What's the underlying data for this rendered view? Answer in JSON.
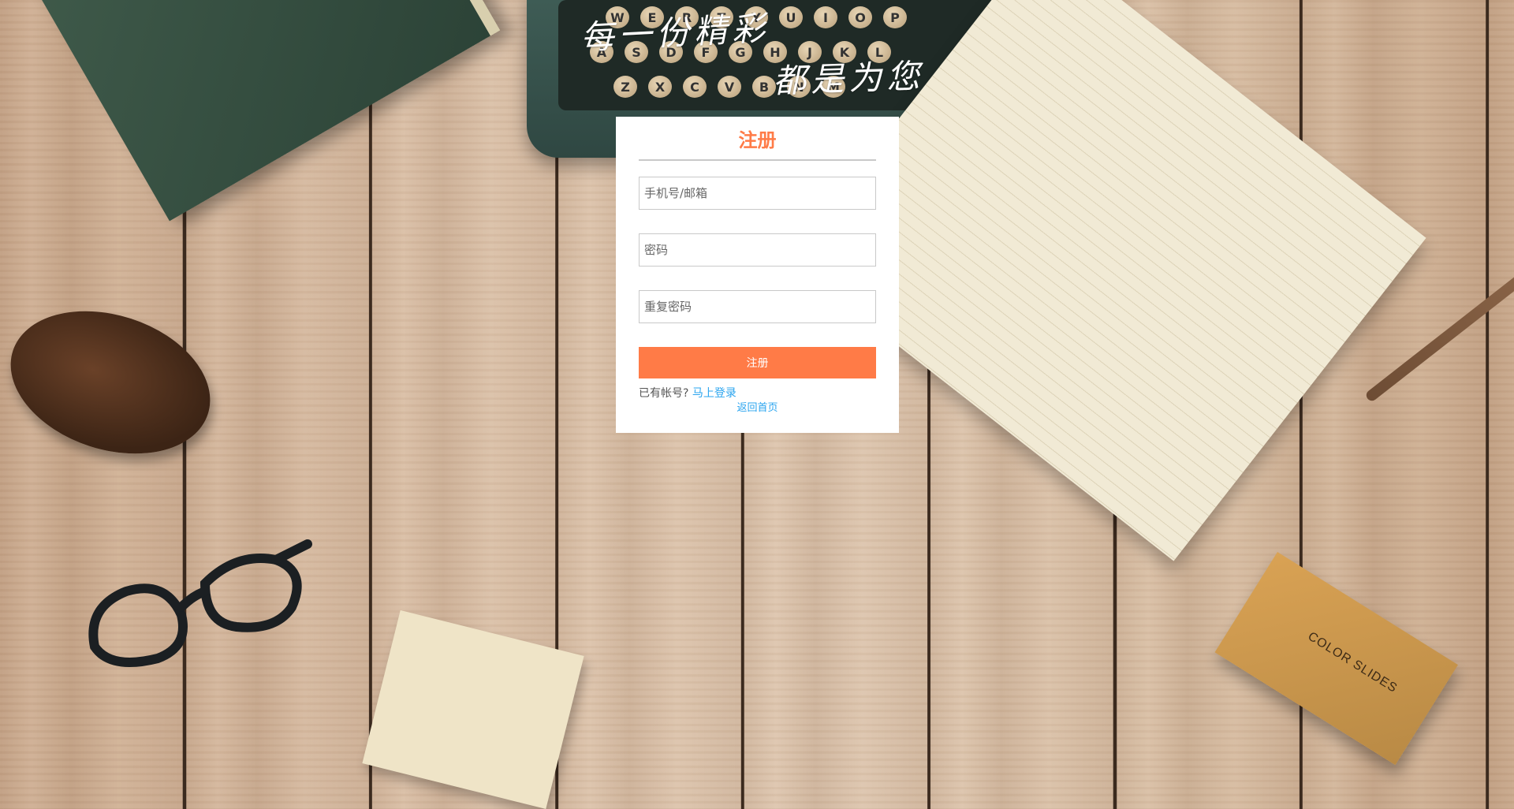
{
  "slogan": {
    "line1": "每一份精彩",
    "line2": "都是为您"
  },
  "register": {
    "title": "注册",
    "account_placeholder": "手机号/邮箱",
    "password_placeholder": "密码",
    "repeat_password_placeholder": "重复密码",
    "submit_label": "注册",
    "has_account_text": "已有帐号?",
    "login_link": "马上登录",
    "home_link": "返回首页"
  },
  "scene": {
    "slides_box_label": "COLOR SLIDES",
    "typewriter_keys_row1": [
      "W",
      "E",
      "R",
      "T",
      "Y",
      "U",
      "I",
      "O",
      "P"
    ],
    "typewriter_keys_row2": [
      "A",
      "S",
      "D",
      "F",
      "G",
      "H",
      "J",
      "K",
      "L"
    ],
    "typewriter_keys_row3": [
      "Z",
      "X",
      "C",
      "V",
      "B",
      "N",
      "M"
    ]
  },
  "colors": {
    "accent": "#ff7b47",
    "link": "#2aa4ef",
    "card_bg": "#ffffff"
  }
}
